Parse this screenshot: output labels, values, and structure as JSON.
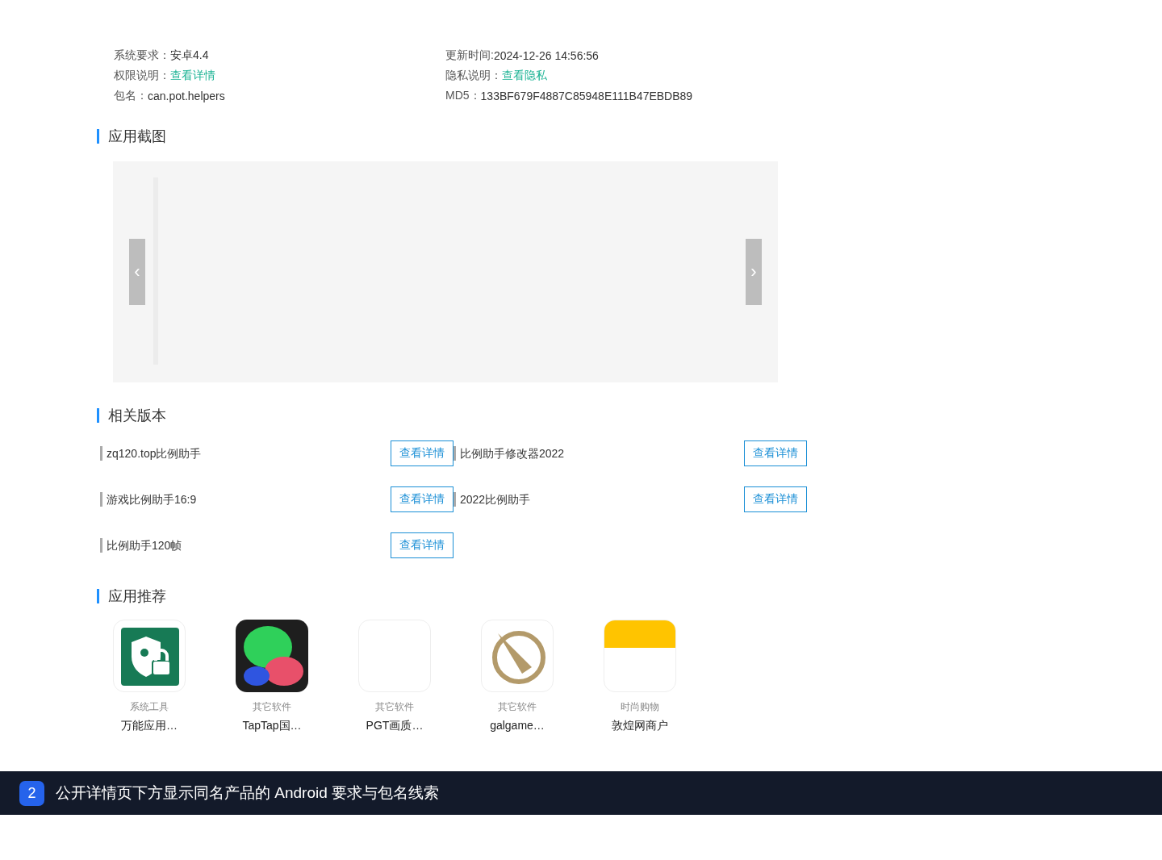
{
  "info": {
    "columns": [
      [
        {
          "label": "系统要求：",
          "value": "安卓4.4",
          "kind": "text"
        },
        {
          "label": "权限说明：",
          "value": "查看详情",
          "kind": "link"
        },
        {
          "label": "包名：",
          "value": "can.pot.helpers",
          "kind": "text"
        }
      ],
      [
        {
          "label": "更新时间: ",
          "value": "2024-12-26 14:56:56",
          "kind": "text"
        },
        {
          "label": "隐私说明：",
          "value": "查看隐私",
          "kind": "link"
        },
        {
          "label": "MD5：",
          "value": "133BF679F4887C85948E111B47EBDB89",
          "kind": "text"
        }
      ]
    ]
  },
  "screenshots": {
    "title": "应用截图",
    "prev": "‹",
    "next": "›"
  },
  "related": {
    "title": "相关版本",
    "items": [
      {
        "name": "zq120.top比例助手",
        "button": "查看详情"
      },
      {
        "name": "比例助手修改器2022",
        "button": "查看详情"
      },
      {
        "name": "游戏比例助手16:9",
        "button": "查看详情"
      },
      {
        "name": "2022比例助手",
        "button": "查看详情"
      },
      {
        "name": "比例助手120帧",
        "button": "查看详情"
      }
    ]
  },
  "recommend": {
    "title": "应用推荐",
    "apps": [
      {
        "kind": "shield",
        "category": "系统工具",
        "name": "万能应用…"
      },
      {
        "kind": "blobs",
        "category": "其它软件",
        "name": "TapTap国…"
      },
      {
        "kind": "blank",
        "category": "其它软件",
        "name": "PGT画质…"
      },
      {
        "kind": "emblem",
        "category": "其它软件",
        "name": "galgame…"
      },
      {
        "kind": "banner",
        "category": "时尚购物",
        "name": "敦煌网商户"
      }
    ]
  },
  "caption": {
    "number": "2",
    "text": "公开详情页下方显示同名产品的 Android 要求与包名线索"
  }
}
